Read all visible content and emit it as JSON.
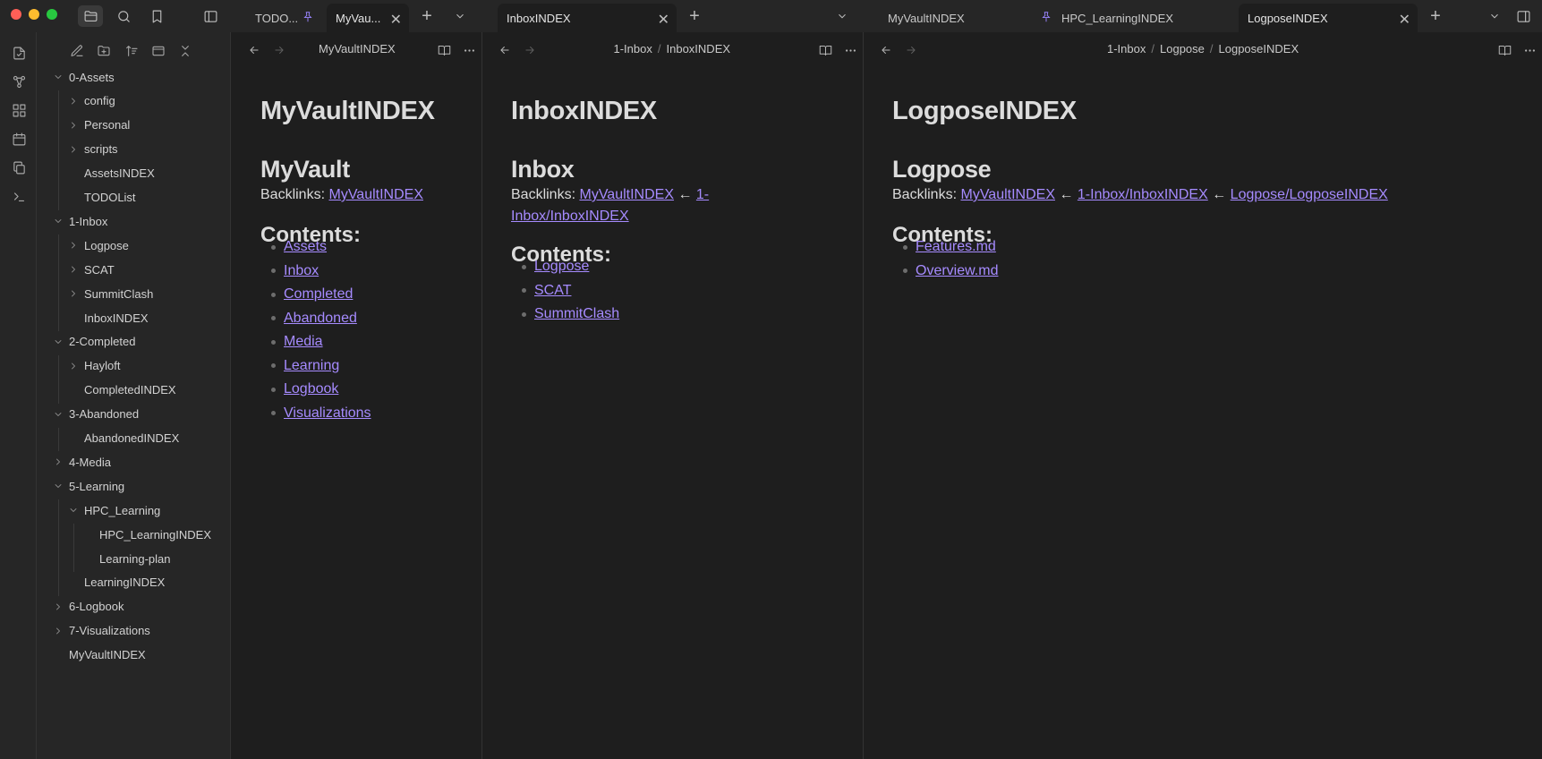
{
  "colors": {
    "accent": "#a68bff",
    "pin": "#9a85ff",
    "bg": "#1e1e1e",
    "chrome": "#262626"
  },
  "titlebar": {
    "icons": [
      "files-icon",
      "search-icon",
      "bookmark-icon",
      "sidebar-toggle-icon"
    ],
    "tabs": [
      {
        "label": "TODO...",
        "pinned": true,
        "active": false
      },
      {
        "label": "MyVau...",
        "pinned": false,
        "active": true
      },
      {
        "label": "InboxINDEX",
        "pinned": false,
        "active": true
      },
      {
        "label": "MyVaultINDEX",
        "pinned": false,
        "active": false
      },
      {
        "label": "HPC_LearningINDEX",
        "pinned": true,
        "active": false
      },
      {
        "label": "LogposeINDEX",
        "pinned": false,
        "active": true
      }
    ]
  },
  "ribbon": {
    "icons": [
      "open-quick-switcher-icon",
      "graph-view-icon",
      "canvas-icon",
      "daily-note-icon",
      "templates-icon",
      "command-palette-icon"
    ]
  },
  "sidebar": {
    "actions": [
      "new-note-icon",
      "new-folder-icon",
      "sort-icon",
      "auto-reveal-icon",
      "collapse-all-icon"
    ],
    "tree": [
      {
        "label": "0-Assets",
        "type": "folder",
        "open": true
      },
      {
        "label": "config",
        "type": "folder",
        "open": false
      },
      {
        "label": "Personal",
        "type": "folder",
        "open": false
      },
      {
        "label": "scripts",
        "type": "folder",
        "open": false
      },
      {
        "label": "AssetsINDEX",
        "type": "file"
      },
      {
        "label": "TODOList",
        "type": "file"
      },
      {
        "label": "1-Inbox",
        "type": "folder",
        "open": true
      },
      {
        "label": "Logpose",
        "type": "folder",
        "open": false
      },
      {
        "label": "SCAT",
        "type": "folder",
        "open": false
      },
      {
        "label": "SummitClash",
        "type": "folder",
        "open": false
      },
      {
        "label": "InboxINDEX",
        "type": "file"
      },
      {
        "label": "2-Completed",
        "type": "folder",
        "open": true
      },
      {
        "label": "Hayloft",
        "type": "folder",
        "open": false
      },
      {
        "label": "CompletedINDEX",
        "type": "file"
      },
      {
        "label": "3-Abandoned",
        "type": "folder",
        "open": true
      },
      {
        "label": "AbandonedINDEX",
        "type": "file"
      },
      {
        "label": "4-Media",
        "type": "folder",
        "open": false
      },
      {
        "label": "5-Learning",
        "type": "folder",
        "open": true
      },
      {
        "label": "HPC_Learning",
        "type": "folder",
        "open": true
      },
      {
        "label": "HPC_LearningINDEX",
        "type": "file"
      },
      {
        "label": "Learning-plan",
        "type": "file"
      },
      {
        "label": "LearningINDEX",
        "type": "file"
      },
      {
        "label": "6-Logbook",
        "type": "folder",
        "open": false
      },
      {
        "label": "7-Visualizations",
        "type": "folder",
        "open": false
      },
      {
        "label": "MyVaultINDEX",
        "type": "file"
      }
    ]
  },
  "panes": [
    {
      "breadcrumb": [
        "MyVaultINDEX"
      ],
      "title": "MyVaultINDEX",
      "heading": "MyVault",
      "backlinks_label": "Backlinks:",
      "backlinks": [
        "MyVaultINDEX"
      ],
      "backlinks_line2": [],
      "contents_label": "Contents:",
      "contents": [
        "Assets",
        "Inbox",
        "Completed",
        "Abandoned",
        "Media",
        "Learning",
        "Logbook",
        "Visualizations"
      ]
    },
    {
      "breadcrumb": [
        "1-Inbox",
        "InboxINDEX"
      ],
      "title": "InboxINDEX",
      "heading": "Inbox",
      "backlinks_label": "Backlinks:",
      "backlinks": [
        "MyVaultINDEX",
        "1-"
      ],
      "backlinks_line2": [
        "Inbox/InboxINDEX"
      ],
      "contents_label": "Contents:",
      "contents": [
        "Logpose",
        "SCAT",
        "SummitClash"
      ]
    },
    {
      "breadcrumb": [
        "1-Inbox",
        "Logpose",
        "LogposeINDEX"
      ],
      "title": "LogposeINDEX",
      "heading": "Logpose",
      "backlinks_label": "Backlinks:",
      "backlinks": [
        "MyVaultINDEX",
        "1-Inbox/InboxINDEX",
        "Logpose/LogposeINDEX"
      ],
      "backlinks_line2": [],
      "contents_label": "Contents:",
      "contents": [
        "Features.md",
        "Overview.md"
      ]
    }
  ],
  "arrow_glyph": "←"
}
